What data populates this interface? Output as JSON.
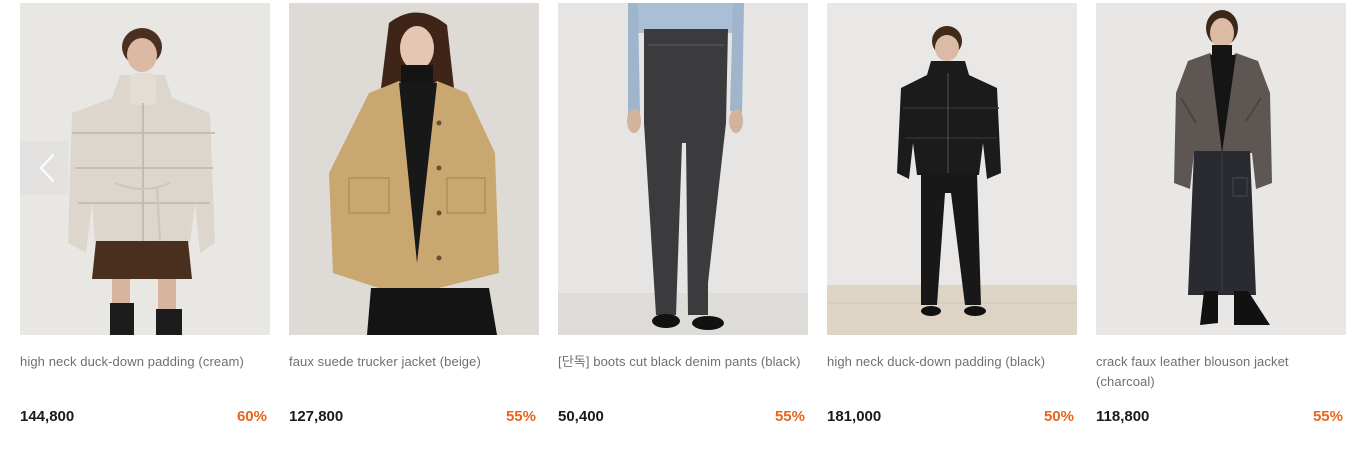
{
  "products": [
    {
      "name": "high neck duck-down padding (cream)",
      "price": "144,800",
      "discount": "60%"
    },
    {
      "name": "faux suede trucker jacket (beige)",
      "price": "127,800",
      "discount": "55%"
    },
    {
      "name": "[단독] boots cut black denim pants (black)",
      "price": "50,400",
      "discount": "55%"
    },
    {
      "name": "high neck duck-down padding (black)",
      "price": "181,000",
      "discount": "50%"
    },
    {
      "name": "crack faux leather blouson jacket (charcoal)",
      "price": "118,800",
      "discount": "55%"
    }
  ],
  "carousel": {
    "prev_icon": "chevron-left-icon"
  },
  "colors": {
    "discount": "#e8651d",
    "price": "#1a1a1a",
    "name": "#6f6f6f"
  }
}
